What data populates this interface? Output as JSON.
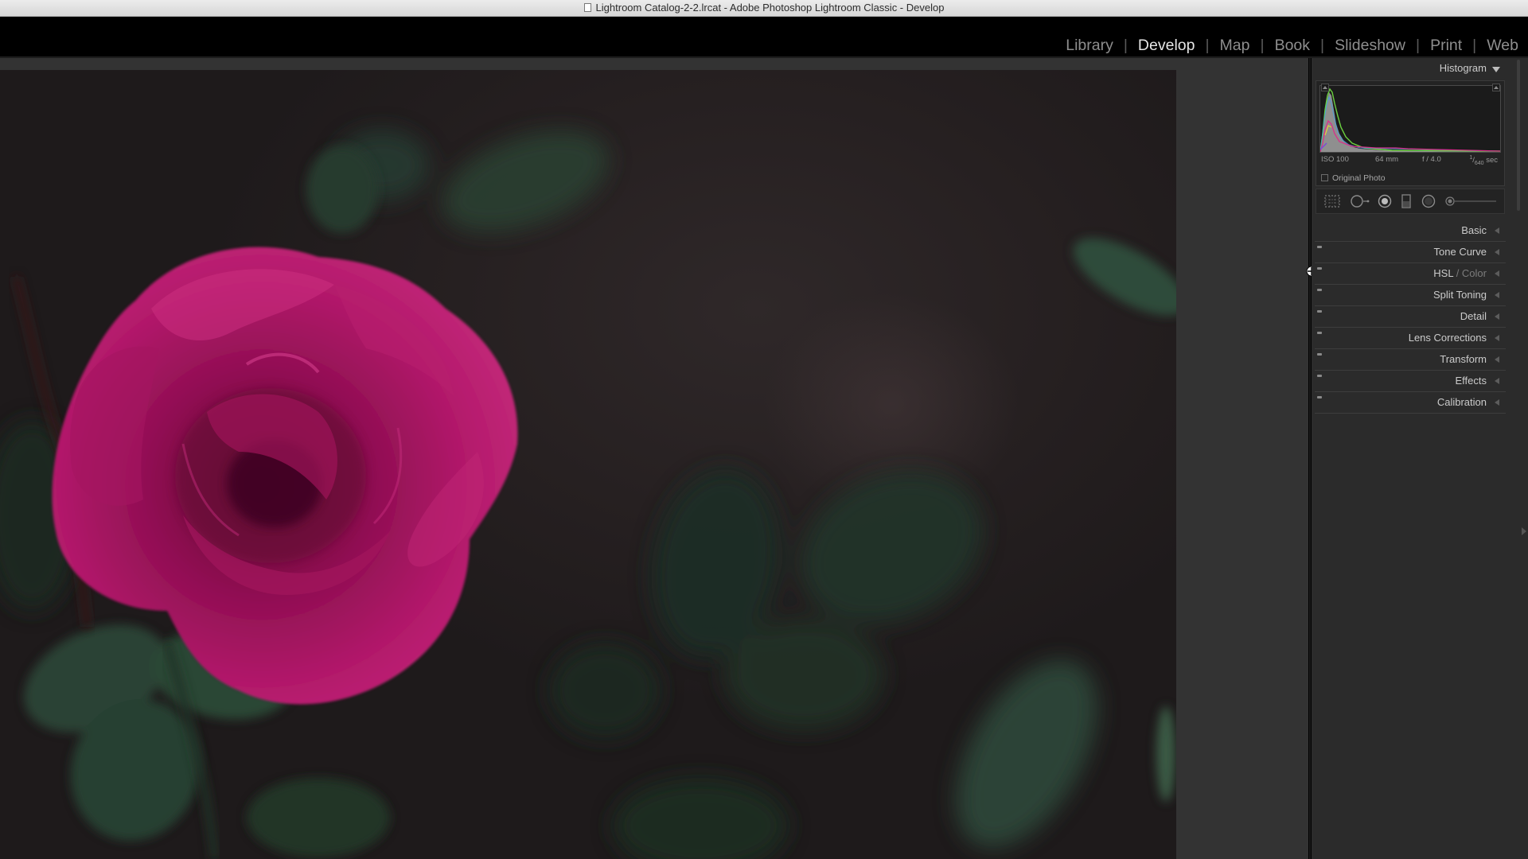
{
  "window": {
    "title": "Lightroom Catalog-2-2.lrcat - Adobe Photoshop Lightroom Classic - Develop"
  },
  "modules": {
    "items": [
      {
        "label": "Library",
        "active": false
      },
      {
        "label": "Develop",
        "active": true
      },
      {
        "label": "Map",
        "active": false
      },
      {
        "label": "Book",
        "active": false
      },
      {
        "label": "Slideshow",
        "active": false
      },
      {
        "label": "Print",
        "active": false
      },
      {
        "label": "Web",
        "active": false
      }
    ],
    "separator": "|"
  },
  "histogram": {
    "title": "Histogram",
    "iso": "ISO 100",
    "focal_length": "64 mm",
    "aperture": "f / 4.0",
    "shutter_numerator": "1",
    "shutter_denominator": "640",
    "shutter_unit": "sec",
    "original_photo_label": "Original Photo"
  },
  "tools": {
    "icons": [
      "crop-overlay-icon",
      "spot-removal-icon",
      "red-eye-icon",
      "graduated-filter-icon",
      "radial-filter-icon",
      "adjustment-brush-icon"
    ]
  },
  "panels": [
    {
      "label": "Basic",
      "has_toggle": false
    },
    {
      "label": "Tone Curve",
      "has_toggle": true
    },
    {
      "label": "HSL",
      "label_suffix": "Color",
      "has_toggle": true
    },
    {
      "label": "Split Toning",
      "has_toggle": true
    },
    {
      "label": "Detail",
      "has_toggle": true
    },
    {
      "label": "Lens Corrections",
      "has_toggle": true
    },
    {
      "label": "Transform",
      "has_toggle": true
    },
    {
      "label": "Effects",
      "has_toggle": true
    },
    {
      "label": "Calibration",
      "has_toggle": true
    }
  ],
  "colors": {
    "rose": "#9c0f5a",
    "leaf": "#243b30",
    "background": "#221d1e",
    "panel": "#2b2b2b",
    "module_active": "#e6e6e6",
    "module_inactive": "#8e8e8e"
  }
}
